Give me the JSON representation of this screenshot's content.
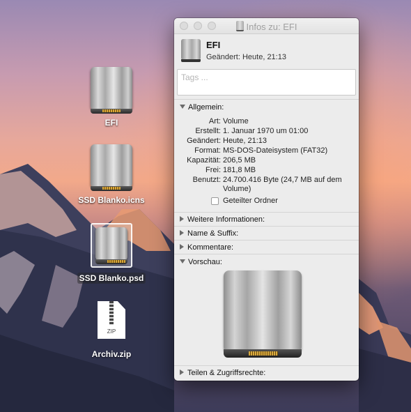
{
  "desktop": {
    "icons": [
      {
        "label": "EFI",
        "kind": "drive"
      },
      {
        "label": "SSD Blanko.icns",
        "kind": "drive"
      },
      {
        "label": "SSD Blanko.psd",
        "kind": "drive",
        "selected": true
      },
      {
        "label": "Archiv.zip",
        "kind": "zip",
        "tag": "ZIP"
      }
    ]
  },
  "window": {
    "title": "Infos zu: EFI",
    "name": "EFI",
    "modified": "Geändert: Heute, 21:13",
    "tags_placeholder": "Tags ...",
    "general": {
      "heading": "Allgemein:",
      "rows": [
        {
          "label": "Art:",
          "value": "Volume"
        },
        {
          "label": "Erstellt:",
          "value": "1. Januar 1970 um 01:00"
        },
        {
          "label": "Geändert:",
          "value": "Heute, 21:13"
        },
        {
          "label": "Format:",
          "value": "MS-DOS-Dateisystem (FAT32)"
        },
        {
          "label": "Kapazität:",
          "value": "206,5 MB"
        },
        {
          "label": "Frei:",
          "value": "181,8 MB"
        },
        {
          "label": "Benutzt:",
          "value": "24.700.416 Byte (24,7 MB auf dem Volume)"
        }
      ],
      "shared_folder": "Geteilter Ordner"
    },
    "sections": {
      "more_info": "Weitere Informationen:",
      "name_suffix": "Name & Suffix:",
      "comments": "Kommentare:",
      "preview": "Vorschau:",
      "sharing": "Teilen & Zugriffsrechte:"
    }
  },
  "colors": {
    "window_bg": "#ececec",
    "desktop_sky_top": "#9a89b3",
    "desktop_sky_glow": "#f2a98a"
  }
}
